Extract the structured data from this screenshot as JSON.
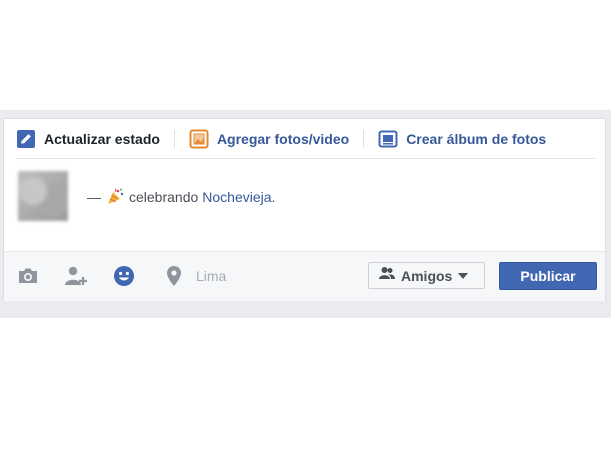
{
  "tabs": {
    "status_label": "Actualizar estado",
    "photos_label": "Agregar fotos/video",
    "album_label": "Crear álbum de fotos"
  },
  "composer": {
    "dash": "—",
    "activity": "celebrando",
    "event": "Nochevieja",
    "period": ".",
    "party_icon": "party-popper-icon"
  },
  "footer": {
    "icons": [
      "camera-icon",
      "tag-friends-icon",
      "feeling-icon",
      "location-icon"
    ],
    "location_placeholder": "Lima",
    "audience_label": "Amigos",
    "publish_label": "Publicar"
  },
  "colors": {
    "brand": "#4267b2",
    "link": "#365899",
    "feeling_icon": "#4267b2",
    "muted_icon": "#90949c",
    "photos_icon": "#e48b32"
  }
}
